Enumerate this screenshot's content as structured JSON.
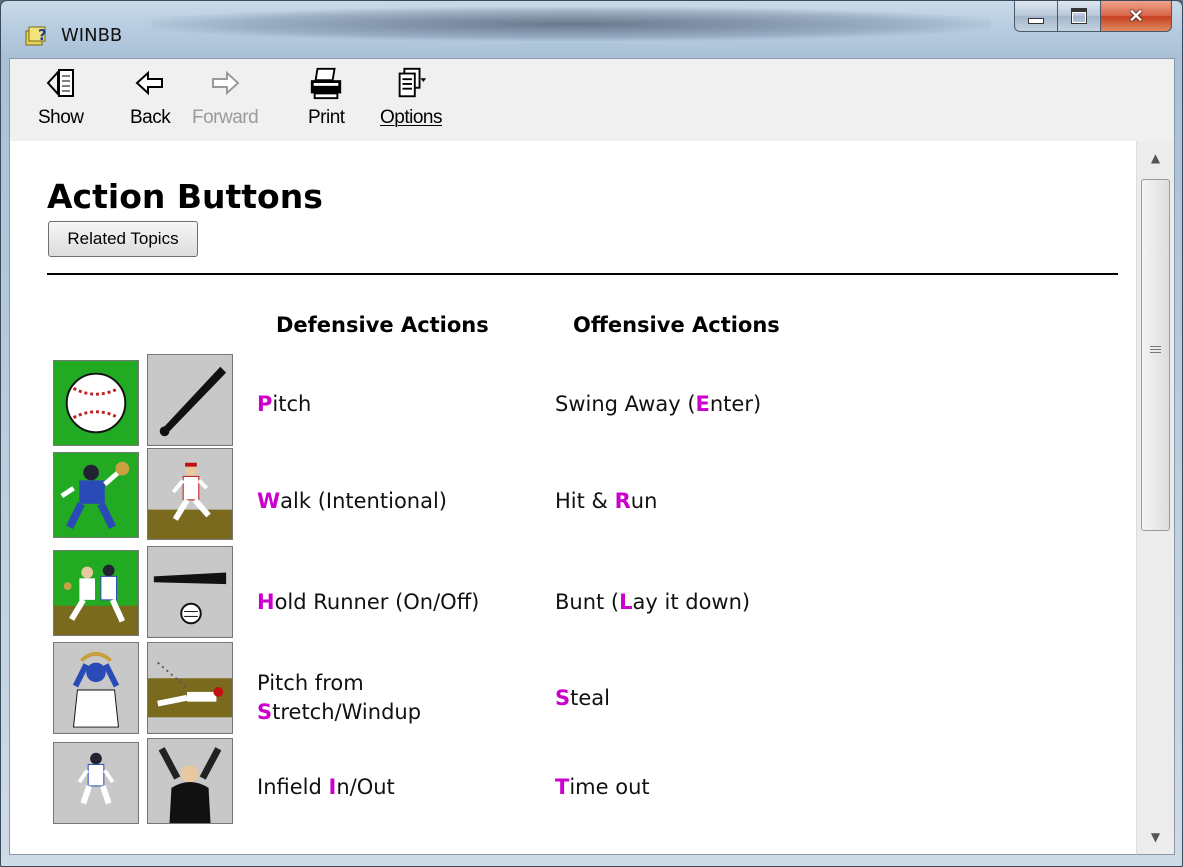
{
  "window": {
    "title": "WINBB"
  },
  "toolbar": {
    "show": "Show",
    "back": "Back",
    "forward": "Forward",
    "print": "Print",
    "options": "Options"
  },
  "page": {
    "heading": "Action Buttons",
    "related_button": "Related Topics",
    "col_defensive": "Defensive Actions",
    "col_offensive": "Offensive Actions"
  },
  "rows": [
    {
      "def": {
        "pre": "",
        "key": "P",
        "post": "itch"
      },
      "off": {
        "pre": "Swing Away (",
        "key": "E",
        "post": "nter)"
      }
    },
    {
      "def": {
        "pre": "",
        "key": "W",
        "post": "alk (Intentional)"
      },
      "off": {
        "pre": "Hit & ",
        "key": "R",
        "post": "un"
      }
    },
    {
      "def": {
        "pre": "",
        "key": "H",
        "post": "old Runner (On/Off)"
      },
      "off": {
        "pre": "Bunt (",
        "key": "L",
        "post": "ay it down)"
      }
    },
    {
      "def": {
        "pre": "Pitch from ",
        "key": "S",
        "post": "tretch/Windup"
      },
      "off": {
        "pre": "",
        "key": "S",
        "post": "teal"
      }
    },
    {
      "def": {
        "pre": "Infield ",
        "key": "I",
        "post": "n/Out"
      },
      "off": {
        "pre": "",
        "key": "T",
        "post": "ime out"
      }
    }
  ],
  "icons": {
    "pitch": "baseball-icon",
    "swing": "bat-icon",
    "walk": "catcher-icon",
    "hitrun": "runner-icon",
    "hold": "pickoff-icon",
    "bunt": "bunt-icon",
    "stretch": "pitcher-stretch-icon",
    "steal": "slide-icon",
    "infield": "infielder-icon",
    "timeout": "umpire-icon"
  },
  "colors": {
    "hotkey": "#cc00cc",
    "field_green": "#22aa22",
    "dirt": "#7a6a1e"
  }
}
